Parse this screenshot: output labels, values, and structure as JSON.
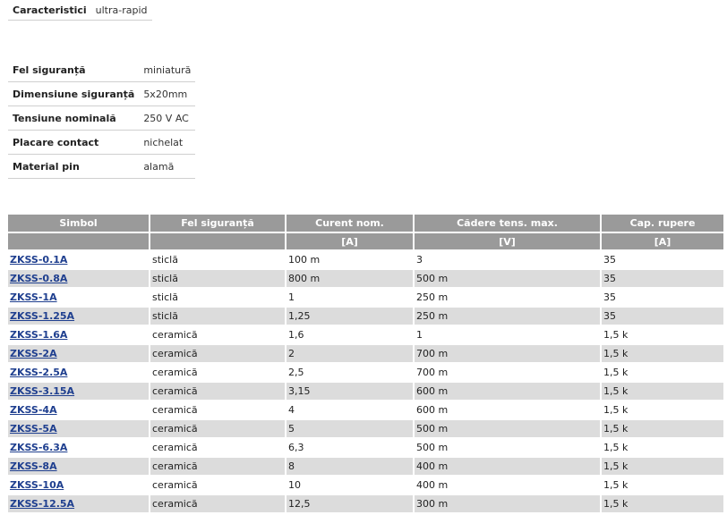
{
  "characteristics": {
    "label": "Caracteristici",
    "value": "ultra-rapid"
  },
  "specs": [
    {
      "label": "Fel siguranță",
      "value": "miniatură"
    },
    {
      "label": "Dimensiune siguranță",
      "value": "5x20mm"
    },
    {
      "label": "Tensiune nominală",
      "value": "250 V AC"
    },
    {
      "label": "Placare contact",
      "value": "nichelat"
    },
    {
      "label": "Material pin",
      "value": "alamă"
    }
  ],
  "table": {
    "headers": [
      "Simbol",
      "Fel siguranță",
      "Curent nom.",
      "Cădere tens. max.",
      "Cap. rupere"
    ],
    "units": [
      "",
      "",
      "[A]",
      "[V]",
      "[A]"
    ],
    "rows": [
      {
        "symbol": "ZKSS-0.1A",
        "type": "sticlă",
        "current": "100 m",
        "drop": "3",
        "breaking": "35"
      },
      {
        "symbol": "ZKSS-0.8A",
        "type": "sticlă",
        "current": "800 m",
        "drop": "500 m",
        "breaking": "35"
      },
      {
        "symbol": "ZKSS-1A",
        "type": "sticlă",
        "current": "1",
        "drop": "250 m",
        "breaking": "35"
      },
      {
        "symbol": "ZKSS-1.25A",
        "type": "sticlă",
        "current": "1,25",
        "drop": "250 m",
        "breaking": "35"
      },
      {
        "symbol": "ZKSS-1.6A",
        "type": "ceramică",
        "current": "1,6",
        "drop": "1",
        "breaking": "1,5 k"
      },
      {
        "symbol": "ZKSS-2A",
        "type": "ceramică",
        "current": "2",
        "drop": "700 m",
        "breaking": "1,5 k"
      },
      {
        "symbol": "ZKSS-2.5A",
        "type": "ceramică",
        "current": "2,5",
        "drop": "700 m",
        "breaking": "1,5 k"
      },
      {
        "symbol": "ZKSS-3.15A",
        "type": "ceramică",
        "current": "3,15",
        "drop": "600 m",
        "breaking": "1,5 k"
      },
      {
        "symbol": "ZKSS-4A",
        "type": "ceramică",
        "current": "4",
        "drop": "600 m",
        "breaking": "1,5 k"
      },
      {
        "symbol": "ZKSS-5A",
        "type": "ceramică",
        "current": "5",
        "drop": "500 m",
        "breaking": "1,5 k"
      },
      {
        "symbol": "ZKSS-6.3A",
        "type": "ceramică",
        "current": "6,3",
        "drop": "500 m",
        "breaking": "1,5 k"
      },
      {
        "symbol": "ZKSS-8A",
        "type": "ceramică",
        "current": "8",
        "drop": "400 m",
        "breaking": "1,5 k"
      },
      {
        "symbol": "ZKSS-10A",
        "type": "ceramică",
        "current": "10",
        "drop": "400 m",
        "breaking": "1,5 k"
      },
      {
        "symbol": "ZKSS-12.5A",
        "type": "ceramică",
        "current": "12,5",
        "drop": "300 m",
        "breaking": "1,5 k"
      }
    ]
  },
  "colors": {
    "header_bg": "#9a9a9a",
    "row_alt_bg": "#dcdcdc",
    "link": "#1f3f8f"
  }
}
